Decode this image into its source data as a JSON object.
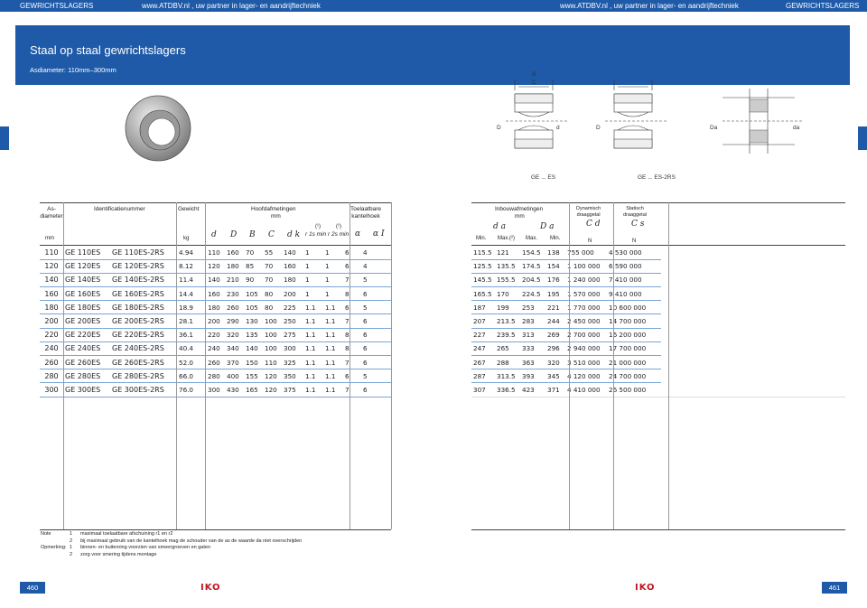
{
  "header": {
    "left_label": "GEWRICHTSLAGERS",
    "center_left": "www.ATDBV.nl , uw partner in lager- en aandrijftechniek",
    "center_right": "www.ATDBV.nl , uw partner in lager- en aandrijftechniek",
    "right_label": "GEWRICHTSLAGERS"
  },
  "banner": {
    "title": "Staal op staal gewrichtslagers",
    "subtitle": "Asdiameter: 110mm–300mm"
  },
  "drawings": {
    "label_es": "GE ... ES",
    "label_2rs": "GE ... ES-2RS",
    "dim_B": "B",
    "dim_C": "C",
    "dim_D": "D",
    "dim_d": "d",
    "dim_dk": "dk",
    "dim_r1": "r1",
    "dim_r2": "r2",
    "dim_Da": "Da",
    "dim_da": "da"
  },
  "left_table": {
    "headers": {
      "shaft": "As-\ndiameter",
      "ident": "Identificatienummer",
      "weight": "Gewicht",
      "main": "Hoofdafmetingen",
      "main_unit": "mm",
      "allow": "Toelaatbare\nkantelhoek",
      "unit_mm": "mm",
      "unit_kg": "kg",
      "d": "d",
      "D": "D",
      "B": "B",
      "C": "C",
      "dk": "d k",
      "r1s": "r 1s min",
      "r2s": "r 2s min",
      "note1a": "(¹)",
      "note1b": "(¹)",
      "alpha": "α",
      "alpha1": "α I"
    },
    "rows": [
      [
        "110",
        "GE 110ES",
        "GE 110ES-2RS",
        "4.94",
        "110",
        "160",
        "70",
        "55",
        "140",
        "1",
        "1",
        "6",
        "4"
      ],
      [
        "120",
        "GE 120ES",
        "GE 120ES-2RS",
        "8.12",
        "120",
        "180",
        "85",
        "70",
        "160",
        "1",
        "1",
        "6",
        "4"
      ],
      [
        "140",
        "GE 140ES",
        "GE 140ES-2RS",
        "11.4",
        "140",
        "210",
        "90",
        "70",
        "180",
        "1",
        "1",
        "7",
        "5"
      ],
      [
        "160",
        "GE 160ES",
        "GE 160ES-2RS",
        "14.4",
        "160",
        "230",
        "105",
        "80",
        "200",
        "1",
        "1",
        "8",
        "6"
      ],
      [
        "180",
        "GE 180ES",
        "GE 180ES-2RS",
        "18.9",
        "180",
        "260",
        "105",
        "80",
        "225",
        "1.1",
        "1.1",
        "6",
        "5"
      ],
      [
        "200",
        "GE 200ES",
        "GE 200ES-2RS",
        "28.1",
        "200",
        "290",
        "130",
        "100",
        "250",
        "1.1",
        "1.1",
        "7",
        "6"
      ],
      [
        "220",
        "GE 220ES",
        "GE 220ES-2RS",
        "36.1",
        "220",
        "320",
        "135",
        "100",
        "275",
        "1.1",
        "1.1",
        "8",
        "6"
      ],
      [
        "240",
        "GE 240ES",
        "GE 240ES-2RS",
        "40.4",
        "240",
        "340",
        "140",
        "100",
        "300",
        "1.1",
        "1.1",
        "8",
        "6"
      ],
      [
        "260",
        "GE 260ES",
        "GE 260ES-2RS",
        "52.0",
        "260",
        "370",
        "150",
        "110",
        "325",
        "1.1",
        "1.1",
        "7",
        "6"
      ],
      [
        "280",
        "GE 280ES",
        "GE 280ES-2RS",
        "66.0",
        "280",
        "400",
        "155",
        "120",
        "350",
        "1.1",
        "1.1",
        "6",
        "5"
      ],
      [
        "300",
        "GE 300ES",
        "GE 300ES-2RS",
        "76.0",
        "300",
        "430",
        "165",
        "120",
        "375",
        "1.1",
        "1.1",
        "7",
        "6"
      ]
    ]
  },
  "right_table": {
    "headers": {
      "mount": "Inbouwafmetingen",
      "mount_unit": "mm",
      "dyn": "Dynamisch\ndraaggetal",
      "stat": "Statisch\ndraaggetal",
      "da": "d a",
      "Da": "D a",
      "Cd": "C d",
      "Cs": "C s",
      "min": "Min.",
      "max2": "Max.(²)",
      "max": "Max.",
      "min2": "Min.",
      "N1": "N",
      "N2": "N"
    },
    "rows": [
      [
        "115.5",
        "121",
        "154.5",
        "138",
        "755 000",
        "4 530 000"
      ],
      [
        "125.5",
        "135.5",
        "174.5",
        "154",
        "1 100 000",
        "6 590 000"
      ],
      [
        "145.5",
        "155.5",
        "204.5",
        "176",
        "1 240 000",
        "7 410 000"
      ],
      [
        "165.5",
        "170",
        "224.5",
        "195",
        "1 570 000",
        "9 410 000"
      ],
      [
        "187",
        "199",
        "253",
        "221",
        "1 770 000",
        "10 600 000"
      ],
      [
        "207",
        "213.5",
        "283",
        "244",
        "2 450 000",
        "14 700 000"
      ],
      [
        "227",
        "239.5",
        "313",
        "269",
        "2 700 000",
        "16 200 000"
      ],
      [
        "247",
        "265",
        "333",
        "296",
        "2 940 000",
        "17 700 000"
      ],
      [
        "267",
        "288",
        "363",
        "320",
        "3 510 000",
        "21 000 000"
      ],
      [
        "287",
        "313.5",
        "393",
        "345",
        "4 120 000",
        "24 700 000"
      ],
      [
        "307",
        "336.5",
        "423",
        "371",
        "4 410 000",
        "26 500 000"
      ]
    ]
  },
  "notes": [
    {
      "label": "Note",
      "num": "1",
      "text": "maximaal toelaatbare afschuining r1 en r2"
    },
    {
      "label": "",
      "num": "2",
      "text": "bij maximaal gebruik van de kantelhoek mag de schouder van de as de waarde da niet overschrijden"
    },
    {
      "label": "Opmerking:",
      "num": "1",
      "text": "binnen- en buitenring voorzien van smeergroeven en gaten"
    },
    {
      "label": "",
      "num": "2",
      "text": "zorg voor smering tijdens montage"
    }
  ],
  "footer": {
    "page_left": "460",
    "page_right": "461",
    "logo": "IKO"
  },
  "colors": {
    "brand": "#1e5aa8",
    "logo": "#c1121f"
  }
}
